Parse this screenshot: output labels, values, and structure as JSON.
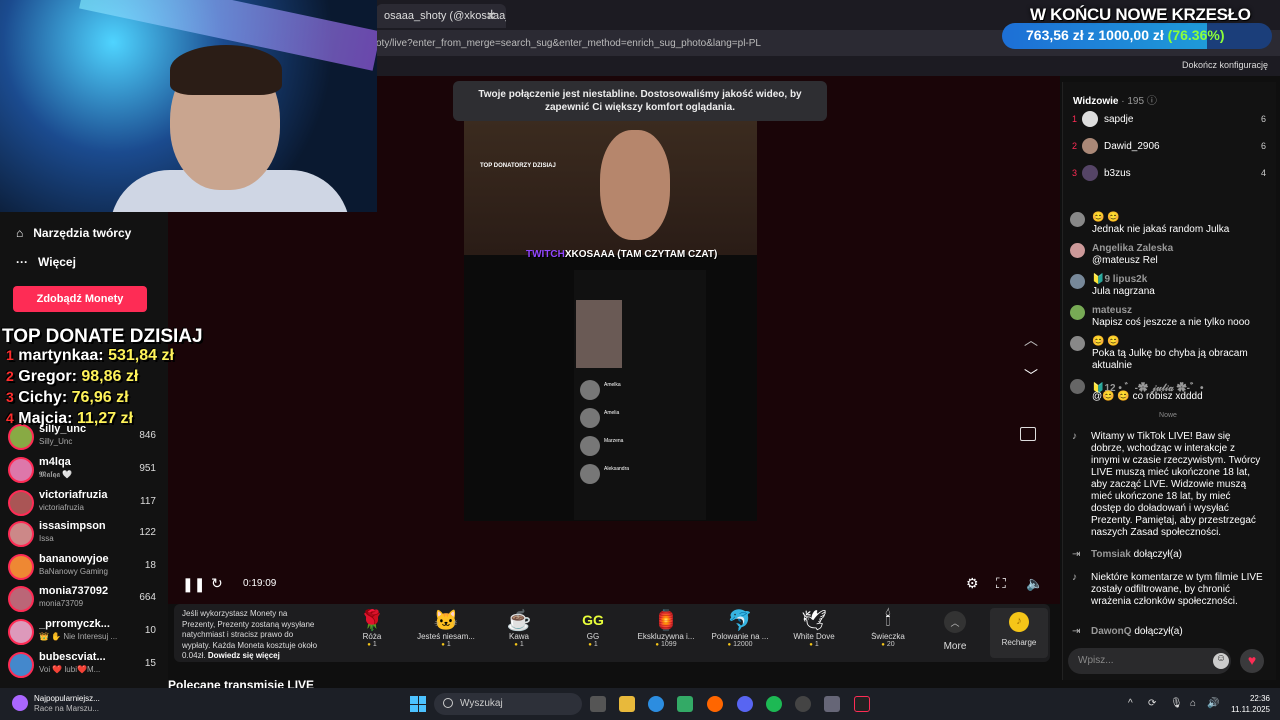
{
  "browser": {
    "tab_title": "osaaa_shoty (@xkosaaa_",
    "url": "oty/live?enter_from_merge=search_sug&enter_method=enrich_sug_photo&lang=pl-PL",
    "bookmark": "Dokończ konfigurację"
  },
  "goal": {
    "title": "W KOŃCU NOWE KRZESŁO",
    "current": "763,56 zł",
    "sep": "z",
    "target": "1000,00 zł",
    "percent": "(76.36%)",
    "progress": 0.7636
  },
  "sidebar": {
    "tools": "Narzędzia twórcy",
    "more": "Więcej",
    "get_coins": "Zdobądź Monety"
  },
  "top_donate": {
    "title": "TOP DONATE DZISIAJ",
    "donors": [
      {
        "rank": "1",
        "name": "martynkaa:",
        "amount": "531,84 zł"
      },
      {
        "rank": "2",
        "name": "Gregor:",
        "amount": "98,86 zł"
      },
      {
        "rank": "3",
        "name": "Cichy:",
        "amount": "76,96 zł"
      },
      {
        "rank": "4",
        "name": "Majcia:",
        "amount": "11,27 zł"
      }
    ]
  },
  "following": [
    {
      "name": "silly_unc",
      "sub": "Silly_Unc",
      "count": "846"
    },
    {
      "name": "m4lqa",
      "sub": "𝕸𝖆𝖑𝖖𝖆 🤍",
      "count": "951"
    },
    {
      "name": "victoriafruzia",
      "sub": "victoriafruzia",
      "count": "117"
    },
    {
      "name": "issasimpson",
      "sub": "Issa",
      "count": "122"
    },
    {
      "name": "bananowyjoe",
      "sub": "BaNanowy Gaming",
      "count": "18"
    },
    {
      "name": "monia737092",
      "sub": "monia73709",
      "count": "664"
    },
    {
      "name": "_prromyczk...",
      "sub": "👑 ✋ Nie Interesuj ...",
      "count": "10"
    },
    {
      "name": "bubescviat...",
      "sub": "Voi ❤️ lubi❤️M...",
      "count": "15"
    }
  ],
  "video": {
    "banner": "Twoje połączenie jest niestabline. Dostosowaliśmy jakość wideo, by zapewnić Ci większy komfort oglądania.",
    "phone_title": "TOP DONATORZY DZISIAJ",
    "stream_label_twitch": "TWITCH",
    "stream_label_name": "XKOSAAA (TAM CZYTAM CZAT)",
    "messages": [
      "Amelka",
      "Amelia",
      "Marzena",
      "Aleksandra"
    ],
    "time": "0:19:09"
  },
  "gifts": {
    "info_text": "Jeśli wykorzystasz Monety na Prezenty, Prezenty zostaną wysyłane natychmiast i stracisz prawo do wypłaty. Każda Moneta kosztuje około 0.04zł.",
    "info_link": "Dowiedz się więcej",
    "items": [
      {
        "icon": "🌹",
        "name": "Róża",
        "price": "1"
      },
      {
        "icon": "🐱",
        "name": "Jesteś niesam...",
        "price": "1"
      },
      {
        "icon": "☕",
        "name": "Kawa",
        "price": "1"
      },
      {
        "icon": "GG",
        "name": "GG",
        "price": "1"
      },
      {
        "icon": "🏮",
        "name": "Ekskluzywna i...",
        "price": "1099"
      },
      {
        "icon": "🐬",
        "name": "Polowanie na ...",
        "price": "12000"
      },
      {
        "icon": "🕊",
        "name": "White Dove",
        "price": "1"
      },
      {
        "icon": "🕯",
        "name": "Świeczka",
        "price": "20"
      }
    ],
    "more": "More",
    "recharge": "Recharge"
  },
  "recommended": "Polecane transmisje LIVE",
  "chat": {
    "viewers_label": "Widzowie",
    "viewers_count": "· 195",
    "top_viewers": [
      {
        "rank": "1",
        "name": "sapdje",
        "count": "6"
      },
      {
        "rank": "2",
        "name": "Dawid_2906",
        "count": "6"
      },
      {
        "rank": "3",
        "name": "b3zus",
        "count": "4"
      }
    ],
    "comments": [
      {
        "user": "😊 😊",
        "text": "Jednak nie jakaś random Julka"
      },
      {
        "user": "Angelika Zaleska",
        "text": "@mateusz Rel"
      },
      {
        "user": "🔰9  lipus2k",
        "text": "Jula nagrzana"
      },
      {
        "user": "mateusz",
        "text": "Napisz coś jeszcze a nie tylko nooo"
      },
      {
        "user": "😊 😊",
        "text": "Poka tą Julkę bo chyba ją obracam aktualnie"
      },
      {
        "user": "🔰12 • ゛-✿ 𝒿𝓊𝓁𝒾𝒶 ✿-゛•",
        "text": "@😊 😊 co robisz xdddd"
      }
    ],
    "new_divider": "Nowe",
    "system_welcome": "Witamy w TikTok LIVE! Baw się dobrze, wchodząc w interakcje z innymi w czasie rzeczywistym. Twórcy LIVE muszą mieć ukończone 18 lat, aby zacząć LIVE. Widzowie muszą mieć ukończone 18 lat, by mieć dostęp do doładowań i wysyłać Prezenty. Pamiętaj, aby przestrzegać naszych Zasad społeczności.",
    "join1_user": "Tomsiak",
    "join1_text": "dołączył(a)",
    "system_filter": "Niektóre komentarze w tym filmie LIVE zostały odfiltrowane, by chronić wrażenia członków społeczności.",
    "join2_user": "DawonQ",
    "join2_text": "dołączył(a)",
    "input_placeholder": "Wpisz..."
  },
  "taskbar": {
    "weather_line1": "Najpopularniejsz...",
    "weather_line2": "Race na Marszu...",
    "search": "Wyszukaj",
    "time": "22:36",
    "date": "11.11.2025"
  }
}
